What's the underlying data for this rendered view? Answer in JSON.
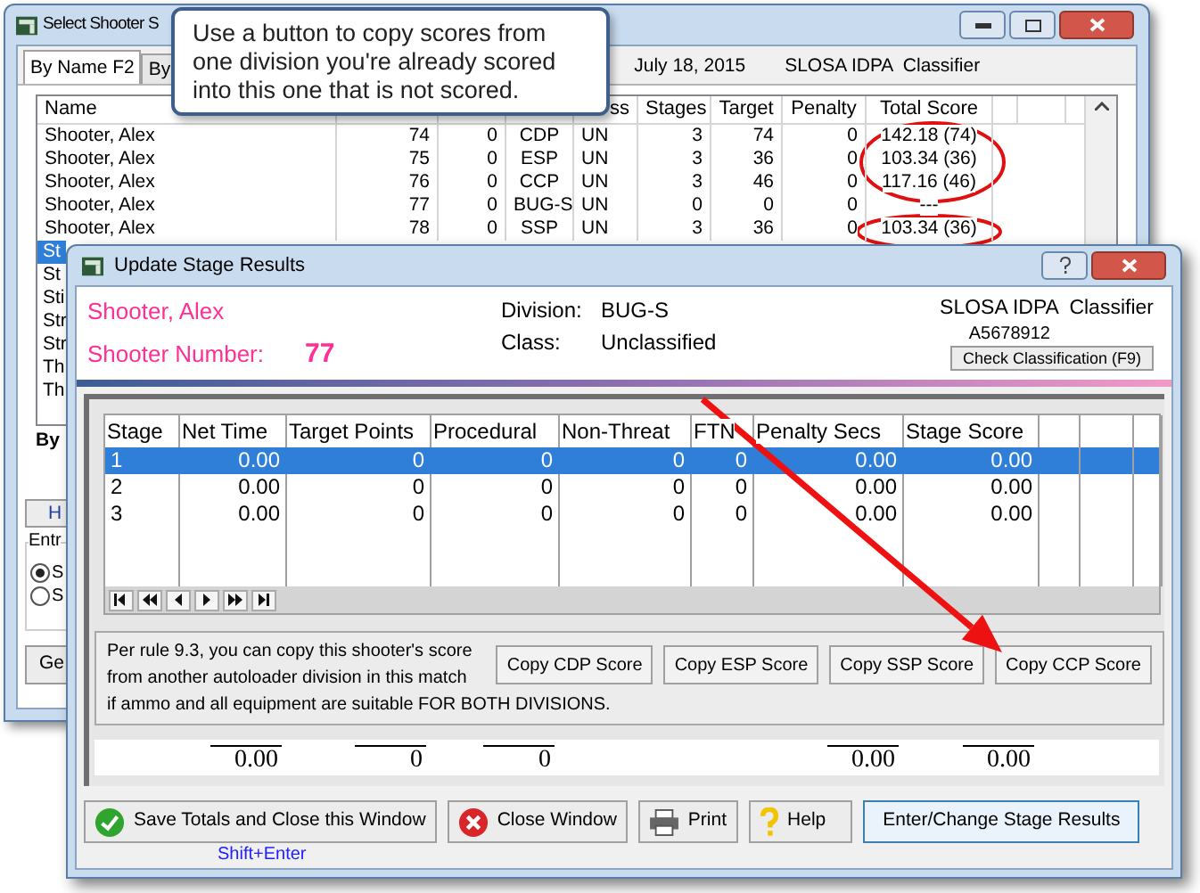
{
  "back_window": {
    "title": "Select Shooter S",
    "tabs": [
      {
        "label": "By Name F2",
        "selected": true
      },
      {
        "label": "By",
        "selected": false
      }
    ],
    "match_date": "July 18, 2015",
    "match_name": "SLOSA IDPA  Classifier",
    "list": {
      "header": {
        "name": "Name",
        "class": "ss",
        "stages": "Stages",
        "target": "Target",
        "penalty": "Penalty",
        "total_score": "Total Score"
      },
      "rows": [
        {
          "name": "Shooter, Alex",
          "number": "74",
          "column_3": "0",
          "division": "CDP",
          "class": "UN",
          "stages": "3",
          "target": "74",
          "penalty": "0",
          "total_score": "142.18 (74)",
          "selected": false
        },
        {
          "name": "Shooter, Alex",
          "number": "75",
          "column_3": "0",
          "division": "ESP",
          "class": "UN",
          "stages": "3",
          "target": "36",
          "penalty": "0",
          "total_score": "103.34 (36)",
          "selected": false
        },
        {
          "name": "Shooter, Alex",
          "number": "76",
          "column_3": "0",
          "division": "CCP",
          "class": "UN",
          "stages": "3",
          "target": "46",
          "penalty": "0",
          "total_score": "117.16 (46)",
          "selected": false
        },
        {
          "name": "Shooter, Alex",
          "number": "77",
          "column_3": "0",
          "division": "BUG-S",
          "class": "UN",
          "stages": "0",
          "target": "0",
          "penalty": "0",
          "total_score": "---",
          "selected": false
        },
        {
          "name": "Shooter, Alex",
          "number": "78",
          "column_3": "0",
          "division": "SSP",
          "class": "UN",
          "stages": "3",
          "target": "36",
          "penalty": "0",
          "total_score": "103.34 (36)",
          "selected": false
        },
        {
          "name": "St",
          "selected": true
        },
        {
          "name": "St",
          "selected": false
        },
        {
          "name": "Sti",
          "selected": false
        },
        {
          "name": "Str",
          "selected": false
        },
        {
          "name": "Str",
          "selected": false
        },
        {
          "name": "Th",
          "selected": false
        },
        {
          "name": "Th",
          "selected": false
        }
      ]
    },
    "sort_label": "By",
    "button_1": "H",
    "group_label": "Entr",
    "radios": [
      {
        "label": "S",
        "selected": true
      },
      {
        "label": "S",
        "selected": false
      }
    ],
    "button_2": "Ge"
  },
  "callout": {
    "text": "Use a button to copy scores from one division you're already scored into this one that is not scored."
  },
  "front_window": {
    "title": "Update Stage Results",
    "shooter_name": "Shooter, Alex",
    "number_label": "Shooter Number:",
    "number": "77",
    "division_label": "Division:",
    "division": "BUG-S",
    "class_label": "Class:",
    "class": "Unclassified",
    "match_name": "SLOSA IDPA  Classifier",
    "member_id": "A5678912",
    "check_button": "Check Classification (F9)",
    "grid": {
      "header": {
        "stage": "Stage",
        "net_time": "Net Time",
        "target_points": "Target Points",
        "procedural": "Procedural",
        "non_threat": "Non-Threat",
        "ftn": "FTN",
        "penalty_secs": "Penalty Secs",
        "stage_score": "Stage Score"
      },
      "rows": [
        {
          "stage": "1",
          "net_time": "0.00",
          "target_points": "0",
          "procedural": "0",
          "non_threat": "0",
          "ftn": "0",
          "penalty_secs": "0.00",
          "stage_score": "0.00",
          "selected": true
        },
        {
          "stage": "2",
          "net_time": "0.00",
          "target_points": "0",
          "procedural": "0",
          "non_threat": "0",
          "ftn": "0",
          "penalty_secs": "0.00",
          "stage_score": "0.00",
          "selected": false
        },
        {
          "stage": "3",
          "net_time": "0.00",
          "target_points": "0",
          "procedural": "0",
          "non_threat": "0",
          "ftn": "0",
          "penalty_secs": "0.00",
          "stage_score": "0.00",
          "selected": false
        }
      ]
    },
    "copy_note": [
      "Per rule 9.3, you can copy this shooter's score",
      "from another autoloader division in this match",
      "if ammo and all equipment are suitable FOR BOTH DIVISIONS."
    ],
    "copy_buttons": [
      "Copy CDP Score",
      "Copy ESP Score",
      "Copy SSP Score",
      "Copy CCP Score"
    ],
    "totals": {
      "net_time": "0.00",
      "target_points": "0",
      "procedural": "0",
      "penalty_secs": "0.00",
      "stage_score": "0.00"
    },
    "buttons": [
      {
        "kind": "save",
        "label": "Save Totals and Close this Window"
      },
      {
        "kind": "close",
        "label": "Close Window"
      },
      {
        "kind": "print",
        "label": "Print"
      },
      {
        "kind": "help",
        "label": "Help"
      },
      {
        "kind": "plain",
        "label": "Enter/Change Stage Results"
      }
    ],
    "shortcut": "Shift+Enter"
  }
}
